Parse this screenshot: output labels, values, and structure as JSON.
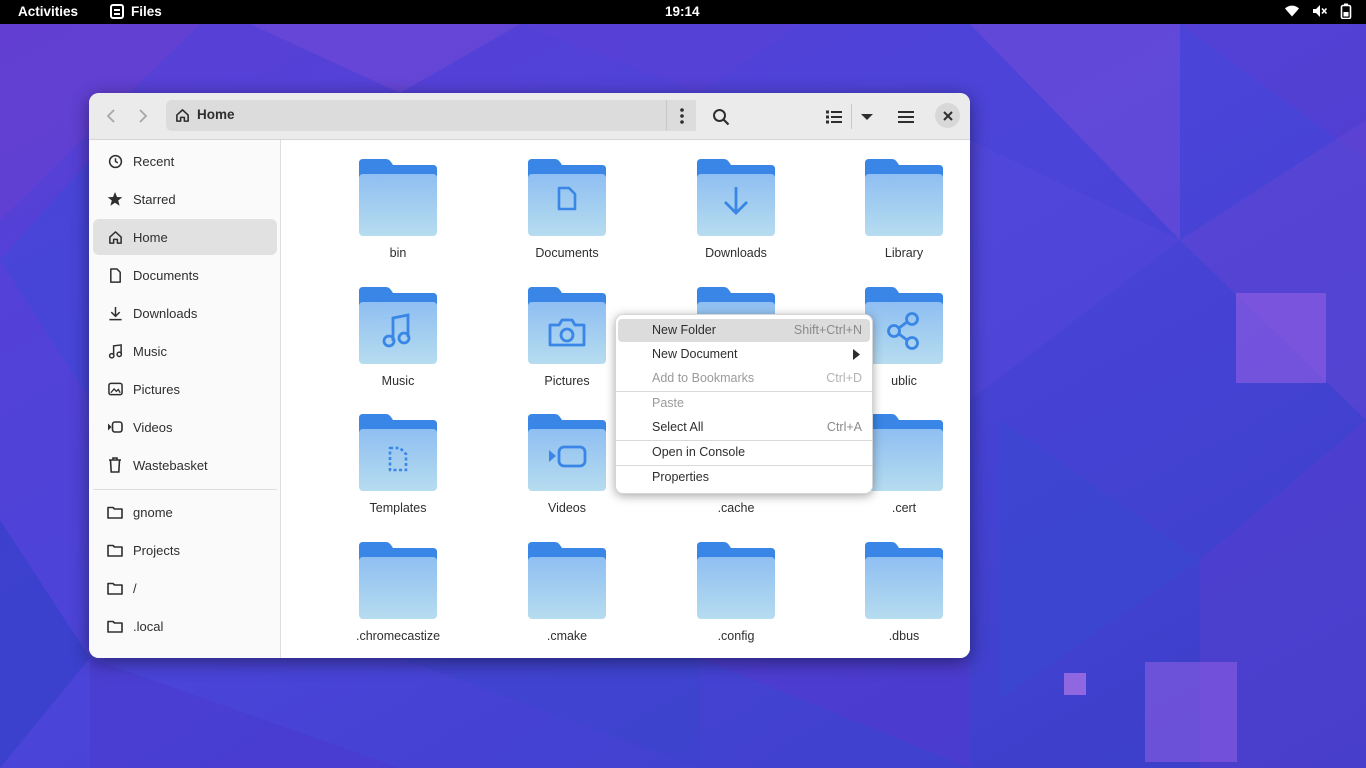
{
  "topbar": {
    "activities": "Activities",
    "app_name": "Files",
    "clock": "19:14",
    "tray_icons": [
      "wifi-icon",
      "volume-muted-icon",
      "battery-icon"
    ]
  },
  "window": {
    "location": "Home",
    "buttons": [
      "back-icon",
      "forward-icon",
      "path-menu-icon",
      "search-icon",
      "list-view-icon",
      "view-options-icon",
      "hamburger-menu-icon",
      "close-icon"
    ]
  },
  "sidebar": {
    "places": [
      {
        "label": "Recent",
        "icon": "clock-icon"
      },
      {
        "label": "Starred",
        "icon": "star-icon"
      },
      {
        "label": "Home",
        "icon": "home-icon",
        "active": true
      },
      {
        "label": "Documents",
        "icon": "document-icon"
      },
      {
        "label": "Downloads",
        "icon": "download-icon"
      },
      {
        "label": "Music",
        "icon": "music-icon"
      },
      {
        "label": "Pictures",
        "icon": "picture-icon"
      },
      {
        "label": "Videos",
        "icon": "video-icon"
      },
      {
        "label": "Wastebasket",
        "icon": "trash-icon"
      }
    ],
    "bookmarks": [
      {
        "label": "gnome",
        "icon": "folder-icon"
      },
      {
        "label": "Projects",
        "icon": "folder-icon"
      },
      {
        "label": "/",
        "icon": "folder-icon"
      },
      {
        "label": ".local",
        "icon": "folder-icon"
      }
    ]
  },
  "files": [
    {
      "name": "bin",
      "emblem": "none"
    },
    {
      "name": "Documents",
      "emblem": "document"
    },
    {
      "name": "Downloads",
      "emblem": "download"
    },
    {
      "name": "Library",
      "emblem": "none"
    },
    {
      "name": "Music",
      "emblem": "music"
    },
    {
      "name": "Pictures",
      "emblem": "camera"
    },
    {
      "name": "",
      "emblem": "none"
    },
    {
      "name": "ublic",
      "emblem": "share"
    },
    {
      "name": "Templates",
      "emblem": "template"
    },
    {
      "name": "Videos",
      "emblem": "video"
    },
    {
      "name": ".cache",
      "emblem": "none"
    },
    {
      "name": ".cert",
      "emblem": "none"
    },
    {
      "name": ".chromecastize",
      "emblem": "none"
    },
    {
      "name": ".cmake",
      "emblem": "none"
    },
    {
      "name": ".config",
      "emblem": "none"
    },
    {
      "name": ".dbus",
      "emblem": "none"
    }
  ],
  "context_menu": {
    "items": [
      {
        "label": "New Folder",
        "accel": "Shift+Ctrl+N",
        "state": "hover"
      },
      {
        "label": "New Document",
        "accel": "",
        "submenu": true
      },
      {
        "label": "Add to Bookmarks",
        "accel": "Ctrl+D",
        "state": "disabled"
      },
      {
        "label": "Paste",
        "accel": "",
        "state": "disabled"
      },
      {
        "label": "Select All",
        "accel": "Ctrl+A"
      },
      {
        "label": "Open in Console",
        "accel": ""
      },
      {
        "label": "Properties",
        "accel": ""
      }
    ]
  },
  "colors": {
    "folder_top": "#3a86e6",
    "folder_body_top": "#8fbff2",
    "folder_body_bottom": "#b6dcef",
    "emblem": "#3a86e6"
  }
}
